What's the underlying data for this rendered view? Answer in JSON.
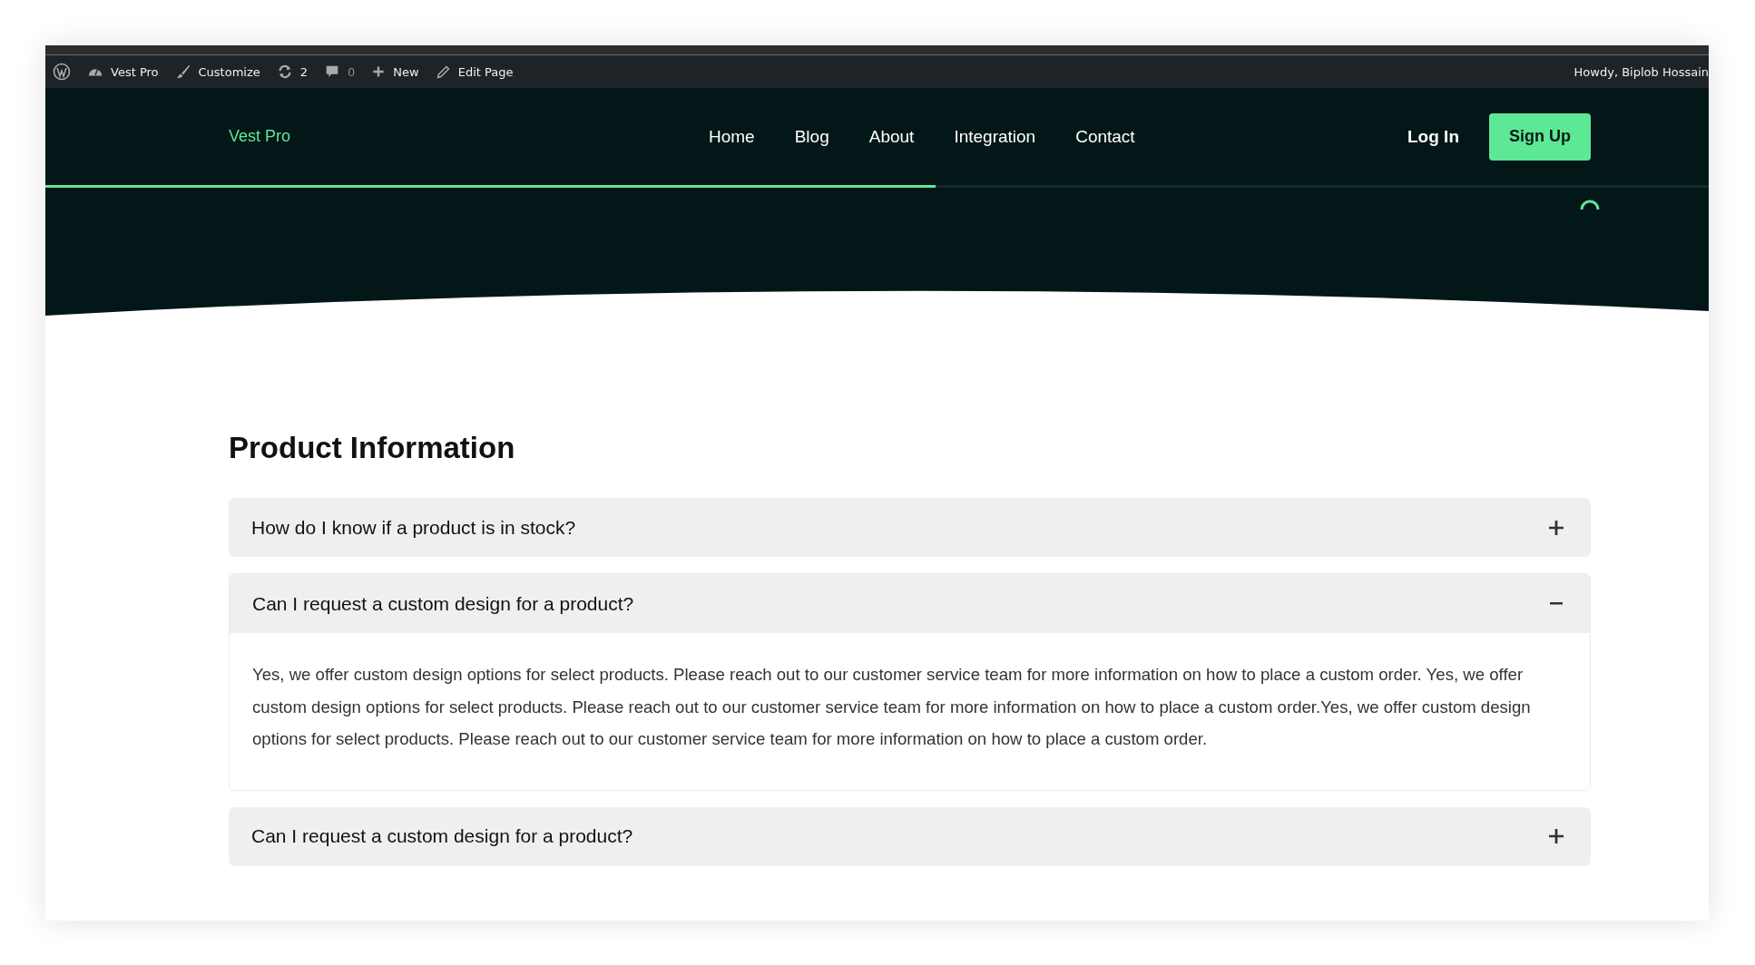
{
  "admin_bar": {
    "site": "Vest Pro",
    "customize": "Customize",
    "updates": "2",
    "comments": "0",
    "new": "New",
    "edit": "Edit Page",
    "greeting": "Howdy, Biplob Hossain"
  },
  "header": {
    "logo": "Vest Pro",
    "nav": [
      {
        "label": "Home"
      },
      {
        "label": "Blog"
      },
      {
        "label": "About"
      },
      {
        "label": "Integration"
      },
      {
        "label": "Contact"
      }
    ],
    "login": "Log In",
    "signup": "Sign Up",
    "scroll_progress": {
      "level": 0.535
    }
  },
  "faq": {
    "title": "Product Information",
    "items": [
      {
        "question": "How do I know if a product is in stock?",
        "expanded": false
      },
      {
        "question": "Can I request a custom design for a product?",
        "expanded": true,
        "answer": "Yes, we offer custom design options for select products. Please reach out to our customer service team for more information on how to place a custom order. Yes, we offer custom design options for select products. Please reach out to our customer service team for more information on how to place a custom order.Yes, we offer custom design options for select products. Please reach out to our customer service team for more information on how to place a custom order."
      },
      {
        "question": "Can I request a custom design for a product?",
        "expanded": false
      }
    ]
  }
}
